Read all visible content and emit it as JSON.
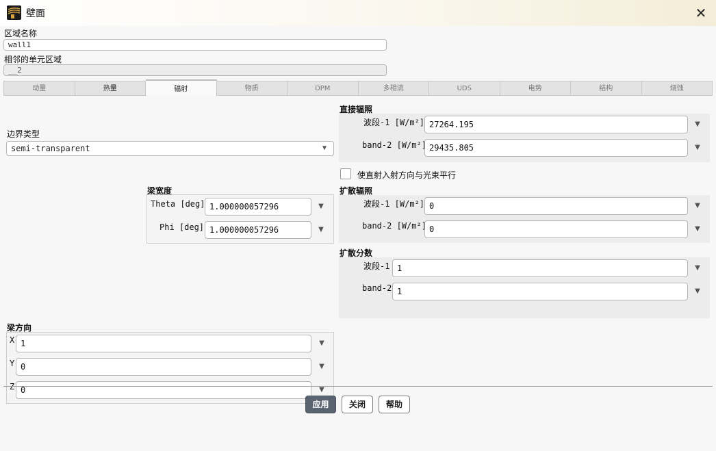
{
  "window": {
    "title": "壁面",
    "close_symbol": "✕"
  },
  "zone": {
    "name_label": "区域名称",
    "name_value": "wall1",
    "adjacent_label": "相邻的单元区域",
    "adjacent_value": "__2"
  },
  "tabs": [
    {
      "label": "动量"
    },
    {
      "label": "热量"
    },
    {
      "label": "辐射"
    },
    {
      "label": "物质"
    },
    {
      "label": "DPM"
    },
    {
      "label": "多相流"
    },
    {
      "label": "UDS"
    },
    {
      "label": "电势"
    },
    {
      "label": "结构"
    },
    {
      "label": "烧蚀"
    }
  ],
  "active_tab": "辐射",
  "boundary": {
    "label": "边界类型",
    "value": "semi-transparent"
  },
  "beam_width": {
    "title": "梁宽度",
    "theta_label": "Theta [deg]",
    "theta_value": "1.000000057296",
    "phi_label": "Phi [deg]",
    "phi_value": "1.000000057296"
  },
  "beam_direction": {
    "title": "梁方向",
    "x_label": "X",
    "x_value": "1",
    "y_label": "Y",
    "y_value": "0",
    "z_label": "Z",
    "z_value": "0"
  },
  "direct_irradiation": {
    "title": "直接辐照",
    "band1_label": "波段-1 [W/m²]",
    "band1_value": "27264.195",
    "band2_label": "band-2 [W/m²]",
    "band2_value": "29435.805"
  },
  "parallel_checkbox": {
    "label": "使直射入射方向与光束平行",
    "checked": false
  },
  "diffuse_irradiation": {
    "title": "扩散辐照",
    "band1_label": "波段-1 [W/m²]",
    "band1_value": "0",
    "band2_label": "band-2 [W/m²]",
    "band2_value": "0"
  },
  "diffuse_fraction": {
    "title": "扩散分数",
    "band1_label": "波段-1",
    "band1_value": "1",
    "band2_label": "band-2",
    "band2_value": "1"
  },
  "buttons": {
    "apply": "应用",
    "close": "关闭",
    "help": "帮助"
  },
  "colors": {
    "primary_button": "#5a6470",
    "titlebar_tint": "#f4edd8"
  }
}
